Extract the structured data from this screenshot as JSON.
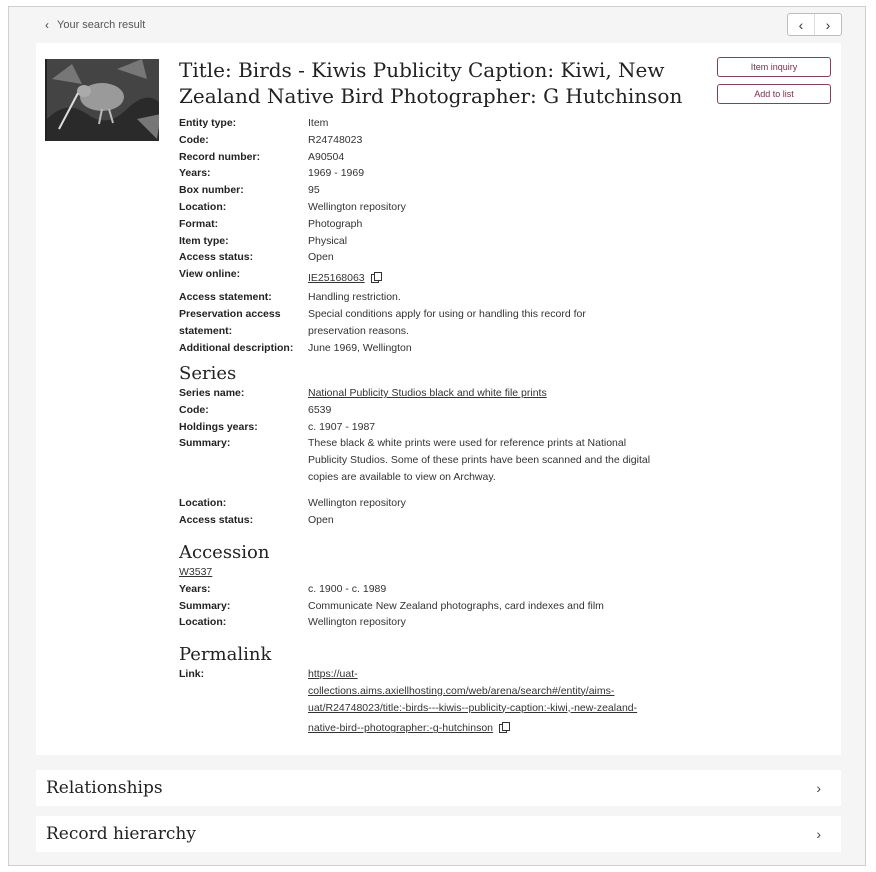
{
  "nav": {
    "back_label": "Your search result",
    "back_icon": "chevron-left-icon",
    "prev_icon": "‹",
    "next_icon": "›"
  },
  "item": {
    "title": "Title: Birds - Kiwis Publicity Caption: Kiwi, New Zealand Native Bird Photographer: G Hutchinson",
    "inquiry_label": "Item inquiry",
    "add_label": "Add to list",
    "fields": [
      {
        "label": "Entity type:",
        "value": "Item"
      },
      {
        "label": "Code:",
        "value": "R24748023"
      },
      {
        "label": "Record number:",
        "value": "A90504"
      },
      {
        "label": "Years:",
        "value": "1969 - 1969"
      },
      {
        "label": "Box number:",
        "value": "95"
      },
      {
        "label": "Location:",
        "value": "Wellington repository"
      },
      {
        "label": "Format:",
        "value": "Photograph"
      },
      {
        "label": "Item type:",
        "value": "Physical"
      },
      {
        "label": "Access status:",
        "value": "Open"
      }
    ],
    "view_online_label": "View online:",
    "view_online_value": "IE25168063",
    "fields2": [
      {
        "label": "Access statement:",
        "value": "Handling restriction."
      },
      {
        "label": "Preservation access",
        "value": "Special conditions apply for using or handling this record for"
      },
      {
        "label": "statement:",
        "value": "preservation reasons."
      },
      {
        "label": "Additional description:",
        "value": "June 1969, Wellington"
      }
    ]
  },
  "series": {
    "heading": "Series",
    "name_label": "Series name:",
    "name_value": "National Publicity Studios black and white file prints",
    "code_label": "Code:",
    "code_value": "6539",
    "holdings_label": "Holdings years:",
    "holdings_value": "c. 1907 - 1987",
    "summary_label": "Summary:",
    "summary_lines": [
      "These black & white prints were used for reference prints at National",
      "Publicity Studios. Some of these prints have been scanned and the digital",
      "copies are available to view on Archway."
    ],
    "location_label": "Location:",
    "location_value": "Wellington repository",
    "access_label": "Access status:",
    "access_value": "Open"
  },
  "accession": {
    "heading": "Accession",
    "code": "W3537",
    "years_label": "Years:",
    "years_value": "c. 1900 - c. 1989",
    "summary_label": "Summary:",
    "summary_value": "Communicate New Zealand photographs, card indexes and film",
    "location_label": "Location:",
    "location_value": "Wellington repository"
  },
  "permalink": {
    "heading": "Permalink",
    "link_label": "Link:",
    "link_lines": [
      "https://uat-",
      "collections.aims.axiellhosting.com/web/arena/search#/entity/aims-",
      "uat/R24748023/title:-birds---kiwis--publicity-caption:-kiwi,-new-zealand-",
      "native-bird--photographer:-g-hutchinson"
    ]
  },
  "sections": {
    "relationships": "Relationships",
    "hierarchy": "Record hierarchy"
  }
}
